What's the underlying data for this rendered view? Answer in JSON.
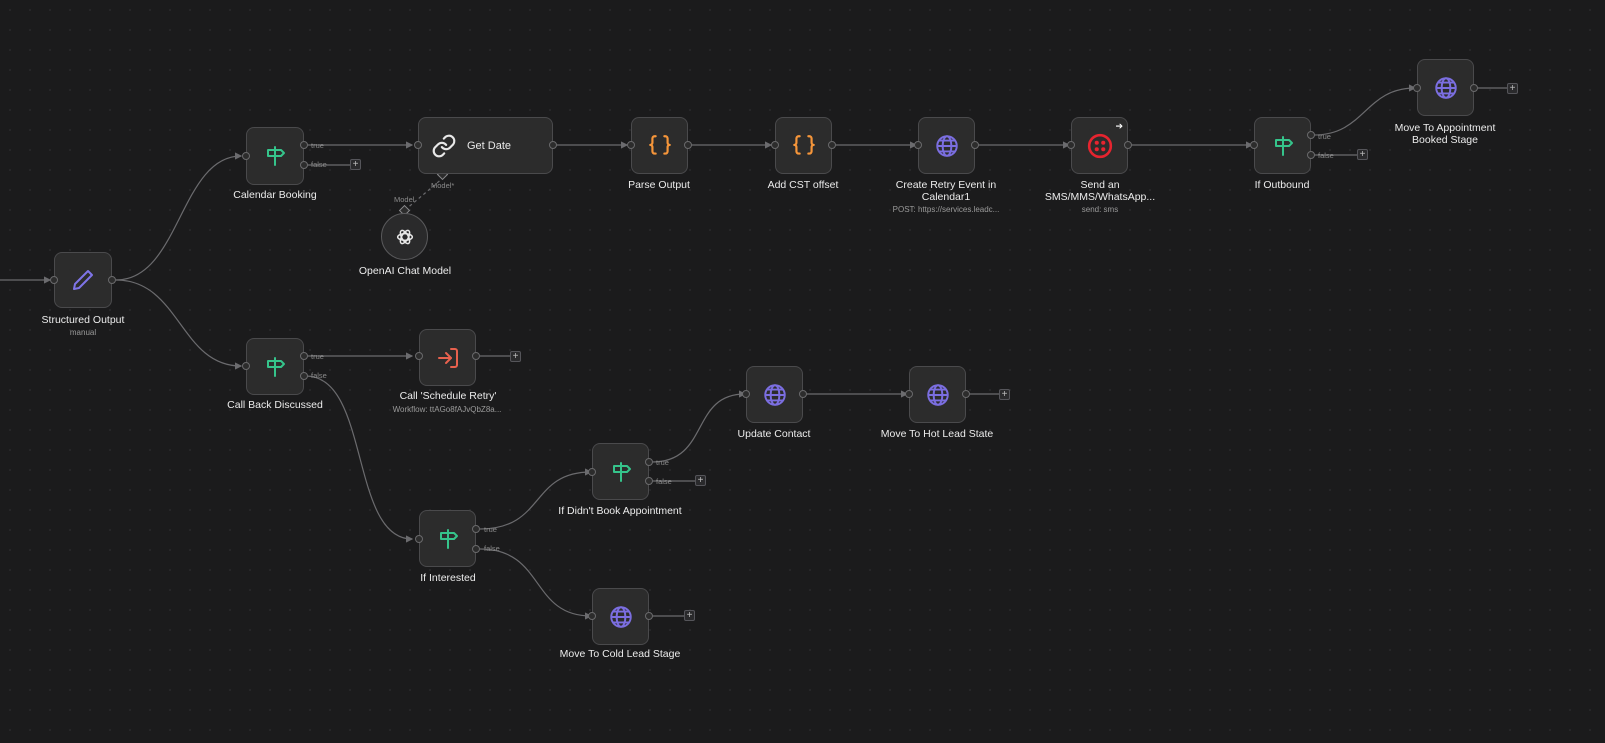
{
  "nodes": {
    "structured_output": {
      "label": "Structured Output",
      "sub": "manual"
    },
    "calendar_booking": {
      "label": "Calendar Booking"
    },
    "get_date": {
      "label": "Get Date"
    },
    "openai_chat_model": {
      "label": "OpenAI Chat Model"
    },
    "parse_output": {
      "label": "Parse Output"
    },
    "add_cst_offset": {
      "label": "Add CST offset"
    },
    "create_retry_event": {
      "label": "Create Retry Event in Calendar1",
      "sub": "POST: https://services.leadc..."
    },
    "send_sms": {
      "label": "Send an SMS/MMS/WhatsApp...",
      "sub": "send: sms"
    },
    "if_outbound": {
      "label": "If Outbound"
    },
    "move_appointment_booked": {
      "label": "Move To Appointment Booked Stage"
    },
    "call_back_discussed": {
      "label": "Call Back Discussed"
    },
    "call_schedule_retry": {
      "label": "Call 'Schedule Retry'",
      "sub": "Workflow: ttAGo8fAJvQbZ8a..."
    },
    "update_contact": {
      "label": "Update Contact"
    },
    "move_hot_lead": {
      "label": "Move To Hot Lead State"
    },
    "if_didnt_book": {
      "label": "If Didn't Book Appointment"
    },
    "if_interested": {
      "label": "If Interested"
    },
    "move_cold_lead": {
      "label": "Move To Cold Lead Stage"
    }
  },
  "edge_labels": {
    "true": "true",
    "false": "false",
    "model": "Model",
    "model_required": "Model*"
  },
  "plus_symbol": "+",
  "arrow_symbol": "➔",
  "colors": {
    "background": "#1b1b1c",
    "node_bg": "#2c2c2c",
    "node_border": "#4a4a4c",
    "edge": "#6b6b6e",
    "if_icon": "#35c48b",
    "code_icon": "#f6963a",
    "http_icon": "#7b6ee0",
    "edit_icon": "#7e74e8",
    "exec_icon": "#e8614e",
    "twilio_icon": "#e6242f",
    "openai_icon": "#e8e8e8"
  },
  "icons": {
    "structured_output": "pencil-icon",
    "if": "signpost-icon",
    "get_date": "link-icon",
    "code": "braces-icon",
    "http": "globe-icon",
    "twilio": "twilio-icon",
    "execute_workflow": "sign-in-icon",
    "openai": "openai-icon"
  }
}
